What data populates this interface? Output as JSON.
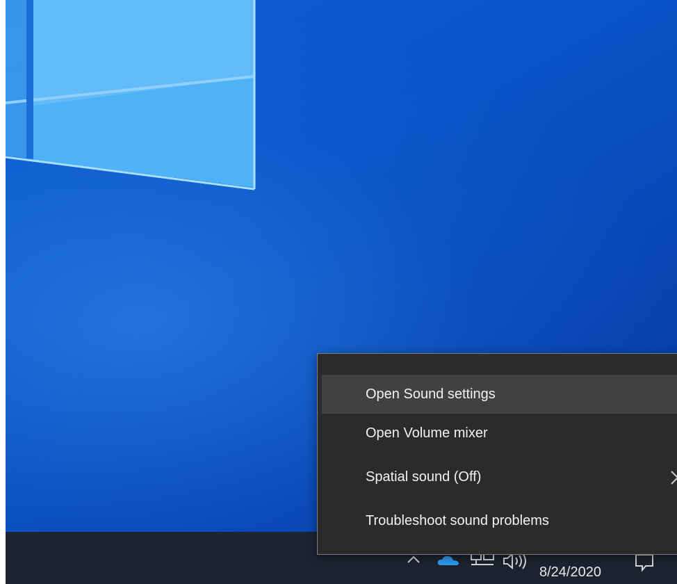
{
  "context_menu": {
    "items": [
      {
        "label": "Open Sound settings",
        "highlighted": true
      },
      {
        "label": "Open Volume mixer"
      },
      {
        "label": "Spatial sound (Off)",
        "has_submenu": true
      },
      {
        "label": "Troubleshoot sound problems"
      }
    ]
  },
  "taskbar": {
    "clock": {
      "date": "8/24/2020"
    },
    "tray_icons": [
      "chevron-up-icon",
      "onedrive-icon",
      "network-icon",
      "speaker-icon",
      "action-center-icon"
    ]
  },
  "colors": {
    "menu_background": "#2b2b2b",
    "menu_highlight": "#414141",
    "taskbar": "#1c2431",
    "desktop": "#0a55c9"
  }
}
